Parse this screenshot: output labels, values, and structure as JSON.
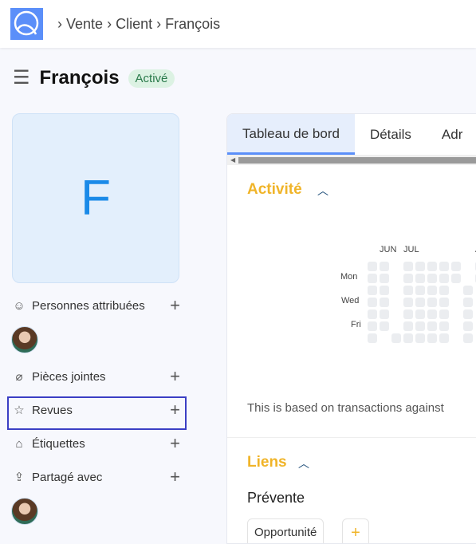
{
  "header": {
    "breadcrumb": [
      "Vente",
      "Client",
      "François"
    ],
    "separator": "›"
  },
  "page": {
    "title": "François",
    "status": "Activé",
    "initial": "F"
  },
  "sidebar": {
    "items": [
      {
        "label": "Personnes attribuées",
        "icon": "user-add-icon",
        "glyph": "☺"
      },
      {
        "label": "Pièces jointes",
        "icon": "paperclip-icon",
        "glyph": "⌀"
      },
      {
        "label": "Revues",
        "icon": "star-icon",
        "glyph": "☆"
      },
      {
        "label": "Étiquettes",
        "icon": "tag-icon",
        "glyph": "⌂"
      },
      {
        "label": "Partagé avec",
        "icon": "share-icon",
        "glyph": "⇪"
      }
    ],
    "add": "+"
  },
  "tabs": [
    {
      "label": "Tableau de bord",
      "active": true
    },
    {
      "label": "Détails"
    },
    {
      "label": "Adr"
    }
  ],
  "activity": {
    "title": "Activité",
    "months": [
      "JUN",
      "JUL",
      "A"
    ],
    "days": [
      "Mon",
      "Wed",
      "Fri"
    ],
    "weeks": [
      [
        0,
        1,
        2,
        3,
        4,
        5,
        6
      ],
      [
        0,
        1,
        2,
        3,
        4,
        5
      ],
      [
        6
      ],
      [
        0,
        1,
        2,
        3,
        4,
        5,
        6
      ],
      [
        0,
        1,
        2,
        3,
        4,
        5,
        6
      ],
      [
        0,
        1,
        2,
        3,
        4,
        5,
        6
      ],
      [
        0,
        1,
        2,
        3,
        4,
        5,
        6
      ],
      [
        0,
        1
      ],
      [
        2,
        3,
        4,
        5,
        6
      ],
      [
        0,
        1
      ]
    ],
    "note": "This is based on transactions against"
  },
  "links": {
    "title": "Liens",
    "group": "Prévente",
    "button": "Opportunité",
    "add": "+"
  },
  "colors": {
    "accent": "#f0b429",
    "primary": "#5b8ff9",
    "highlight": "#3b3fc4"
  }
}
